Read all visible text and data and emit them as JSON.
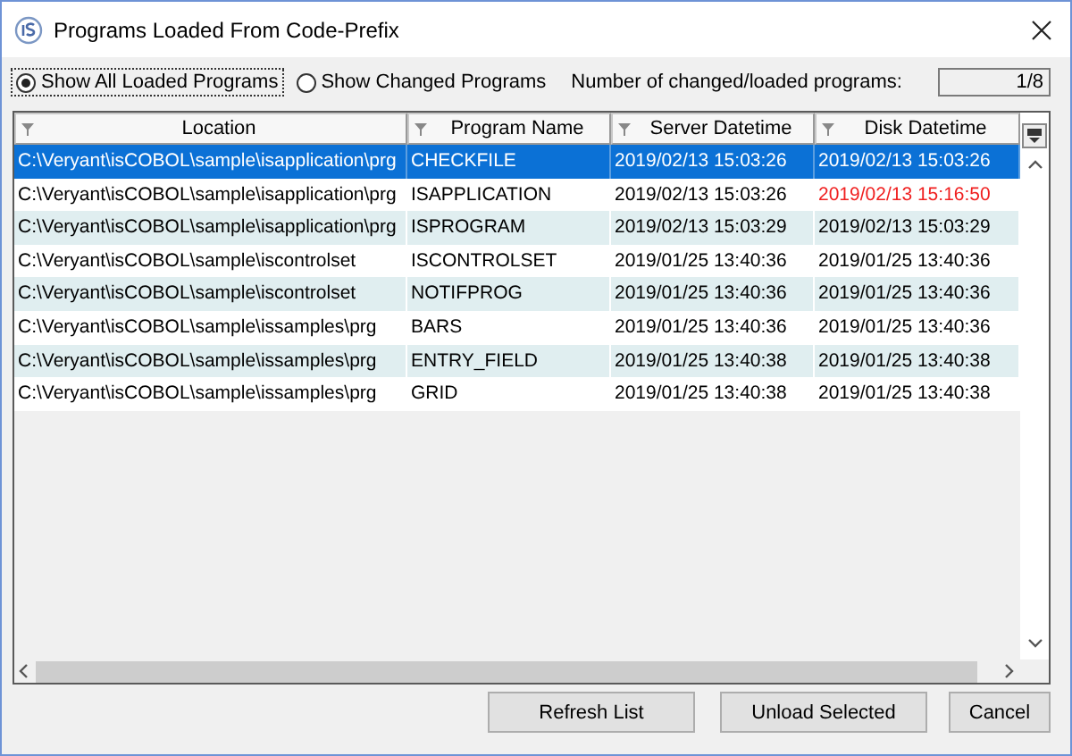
{
  "window": {
    "title": "Programs Loaded From Code-Prefix"
  },
  "filter_options": [
    {
      "label": "Show All Loaded Programs",
      "selected": true
    },
    {
      "label": "Show Changed Programs",
      "selected": false
    }
  ],
  "count": {
    "label": "Number of changed/loaded programs:",
    "value": "1/8"
  },
  "table": {
    "columns": [
      "Location",
      "Program Name",
      "Server Datetime",
      "Disk Datetime"
    ],
    "rows": [
      {
        "cells": [
          "C:\\Veryant\\isCOBOL\\sample\\isapplication\\prg",
          "CHECKFILE",
          "2019/02/13 15:03:26",
          "2019/02/13 15:03:26"
        ],
        "selected": true,
        "changed": false
      },
      {
        "cells": [
          "C:\\Veryant\\isCOBOL\\sample\\isapplication\\prg",
          "ISAPPLICATION",
          "2019/02/13 15:03:26",
          "2019/02/13 15:16:50"
        ],
        "selected": false,
        "changed": true
      },
      {
        "cells": [
          "C:\\Veryant\\isCOBOL\\sample\\isapplication\\prg",
          "ISPROGRAM",
          "2019/02/13 15:03:29",
          "2019/02/13 15:03:29"
        ],
        "selected": false,
        "changed": false
      },
      {
        "cells": [
          "C:\\Veryant\\isCOBOL\\sample\\iscontrolset",
          "ISCONTROLSET",
          "2019/01/25 13:40:36",
          "2019/01/25 13:40:36"
        ],
        "selected": false,
        "changed": false
      },
      {
        "cells": [
          "C:\\Veryant\\isCOBOL\\sample\\iscontrolset",
          "NOTIFPROG",
          "2019/01/25 13:40:36",
          "2019/01/25 13:40:36"
        ],
        "selected": false,
        "changed": false
      },
      {
        "cells": [
          "C:\\Veryant\\isCOBOL\\sample\\issamples\\prg",
          "BARS",
          "2019/01/25 13:40:36",
          "2019/01/25 13:40:36"
        ],
        "selected": false,
        "changed": false
      },
      {
        "cells": [
          "C:\\Veryant\\isCOBOL\\sample\\issamples\\prg",
          "ENTRY_FIELD",
          "2019/01/25 13:40:38",
          "2019/01/25 13:40:38"
        ],
        "selected": false,
        "changed": false
      },
      {
        "cells": [
          "C:\\Veryant\\isCOBOL\\sample\\issamples\\prg",
          "GRID",
          "2019/01/25 13:40:38",
          "2019/01/25 13:40:38"
        ],
        "selected": false,
        "changed": false
      }
    ]
  },
  "buttons": [
    "Refresh List",
    "Unload Selected",
    "Cancel"
  ]
}
